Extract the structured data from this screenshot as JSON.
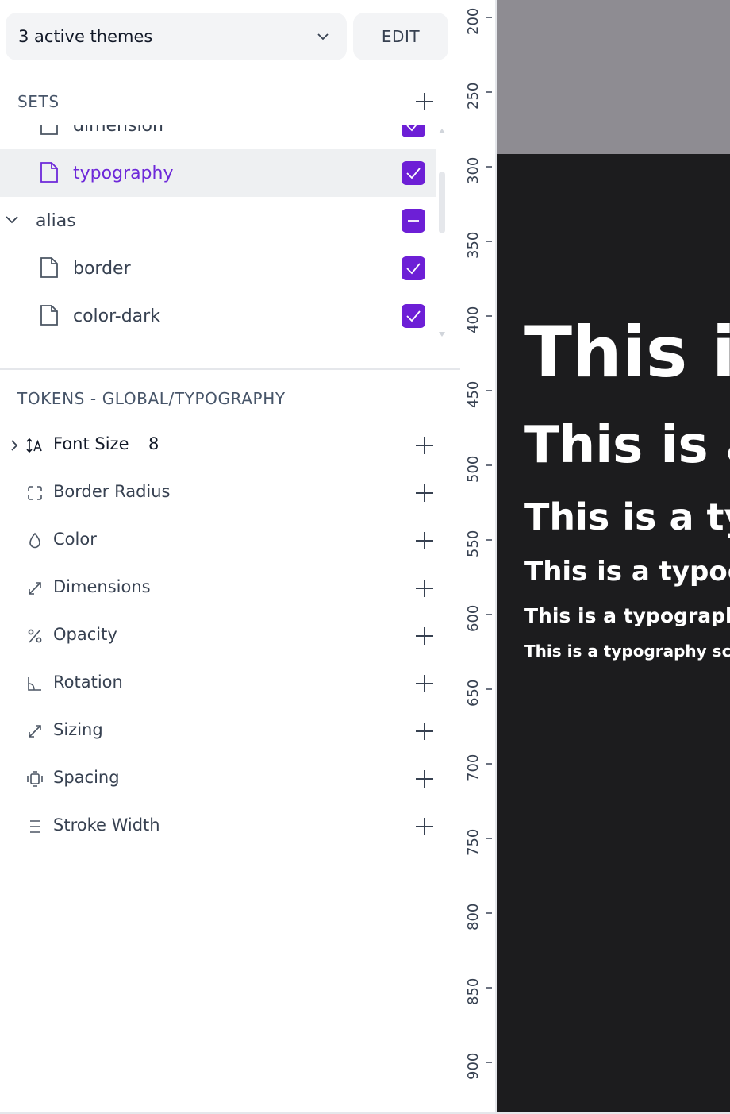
{
  "themes": {
    "selector_label": "3 active themes",
    "edit_label": "EDIT"
  },
  "sets": {
    "title": "SETS",
    "items": [
      {
        "name": "dimension",
        "type": "file",
        "state": "checked"
      },
      {
        "name": "typography",
        "type": "file",
        "state": "checked",
        "active": true
      },
      {
        "name": "alias",
        "type": "group",
        "state": "indeterminate"
      },
      {
        "name": "border",
        "type": "file",
        "state": "checked"
      },
      {
        "name": "color-dark",
        "type": "file",
        "state": "checked"
      }
    ]
  },
  "tokens": {
    "title": "TOKENS - GLOBAL/TYPOGRAPHY",
    "items": [
      {
        "name": "Font Size",
        "count": "8",
        "icon": "font-size-icon"
      },
      {
        "name": "Border Radius",
        "icon": "border-radius-icon"
      },
      {
        "name": "Color",
        "icon": "color-drop-icon"
      },
      {
        "name": "Dimensions",
        "icon": "dimensions-icon"
      },
      {
        "name": "Opacity",
        "icon": "opacity-icon"
      },
      {
        "name": "Rotation",
        "icon": "rotation-icon"
      },
      {
        "name": "Sizing",
        "icon": "sizing-icon"
      },
      {
        "name": "Spacing",
        "icon": "spacing-icon"
      },
      {
        "name": "Stroke Width",
        "icon": "stroke-width-icon"
      }
    ]
  },
  "ruler": {
    "labels": [
      "200",
      "250",
      "300",
      "350",
      "400",
      "450",
      "500",
      "550",
      "600",
      "650",
      "700",
      "750",
      "800",
      "850",
      "900"
    ]
  },
  "canvas": {
    "samples": [
      "This is",
      "This is a",
      "This is a ty",
      "This is a typog",
      "This is a typograph",
      "This is a typography sca"
    ]
  },
  "colors": {
    "accent": "#6d1fd6",
    "canvas_bg": "#1c1c1e",
    "canvas_top": "#8e8c92",
    "panel_bg": "#ffffff"
  }
}
